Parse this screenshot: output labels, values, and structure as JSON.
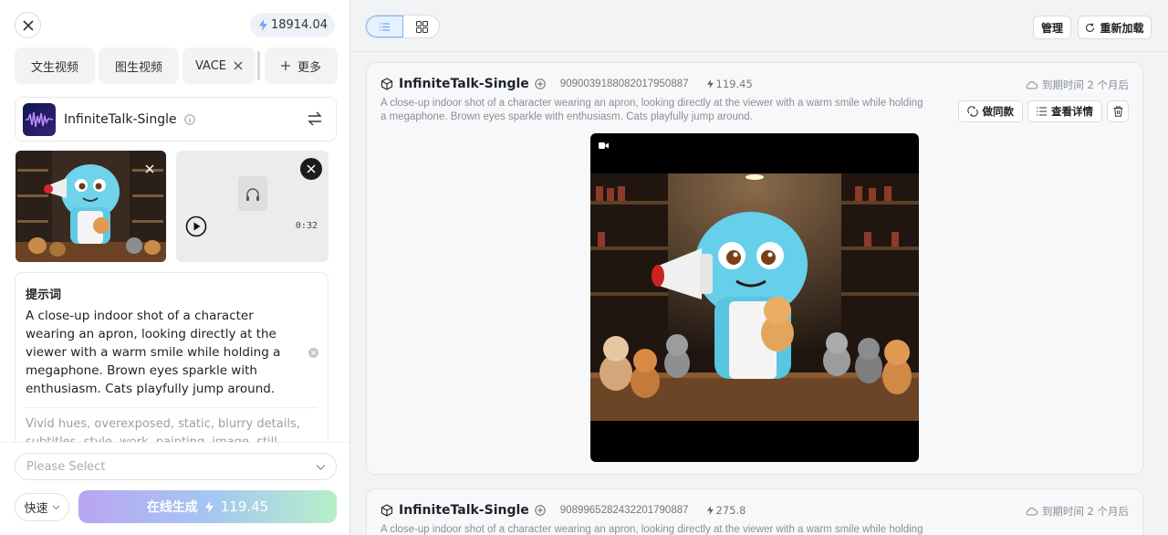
{
  "left_panel": {
    "credits": "18914.04",
    "tabs": [
      "文生视频",
      "图生视频",
      "VACE",
      "更多"
    ],
    "model": {
      "name": "InfiniteTalk-Single"
    },
    "audio": {
      "duration": "0:32"
    },
    "prompt": {
      "title": "提示词",
      "text": "A close-up indoor shot of a character wearing an apron, looking directly at the viewer with a warm smile while holding a megaphone. Brown eyes sparkle with enthusiasm. Cats playfully jump around.",
      "negative": "Vivid hues, overexposed, static, blurry details, subtitles, style, work, painting, image, still"
    },
    "select": {
      "placeholder": "Please Select"
    },
    "speed": {
      "label": "快速"
    },
    "generate": {
      "label": "在线生成",
      "cost": "119.45"
    }
  },
  "right_panel": {
    "toolbar": {
      "manage_label": "管理",
      "reload_label": "重新加载"
    },
    "cards": [
      {
        "title": "InfiniteTalk-Single",
        "id": "909003918808201795088​7",
        "cost": "119.45",
        "expire": "到期时间 2 个月后",
        "desc": "A close-up indoor shot of a character wearing an apron, looking directly at the viewer with a warm smile while holding a megaphone. Brown eyes sparkle with enthusiasm. Cats playfully jump around.",
        "actions": {
          "same_label": "做同款",
          "detail_label": "查看详情"
        }
      },
      {
        "title": "InfiniteTalk-Single",
        "id": "908996528243220179088​7",
        "cost": "275.8",
        "expire": "到期时间 2 个月后",
        "desc": "A close-up indoor shot of a character wearing an apron, looking directly at the viewer with a warm smile while holding a megaphone."
      }
    ]
  },
  "icons": {
    "close": "close-icon",
    "bolt": "bolt-icon",
    "info": "info-icon",
    "swap": "swap-icon",
    "play": "play-icon",
    "headphones": "headphones-icon",
    "chevron": "chevron-down-icon",
    "list": "list-view-icon",
    "grid": "grid-view-icon",
    "refresh": "refresh-icon",
    "cube": "cube-icon",
    "plus_circle": "plus-circle-icon",
    "cloud": "cloud-icon",
    "copy": "copy-style-icon",
    "detail": "detail-list-icon",
    "trash": "trash-icon",
    "camera": "video-camera-icon"
  },
  "colors": {
    "accent": "#4f8ff7",
    "generate_gradient": [
      "#b9a5f2",
      "#a5c6f2",
      "#b6efc9"
    ]
  }
}
